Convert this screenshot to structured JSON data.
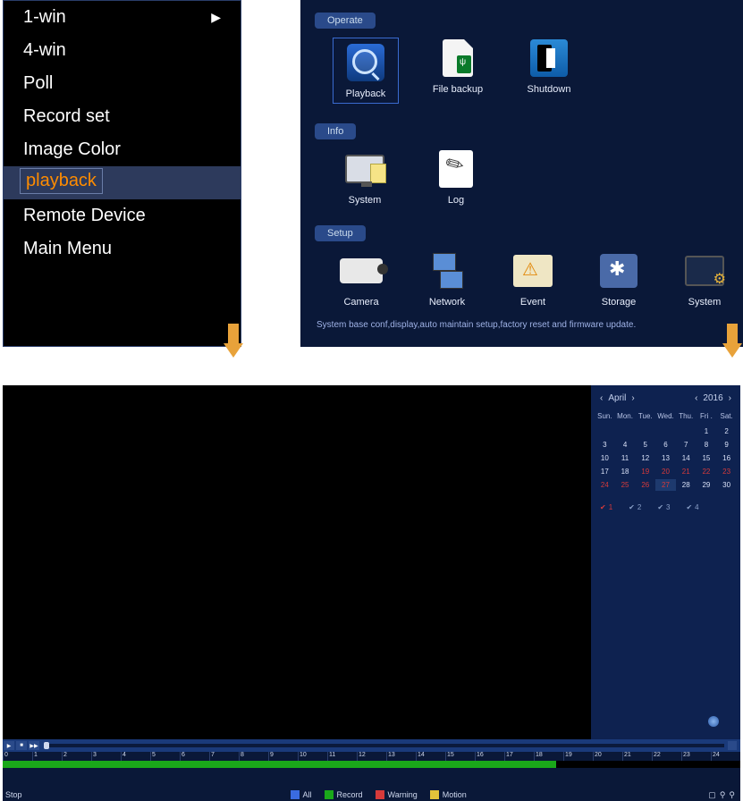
{
  "context_menu": {
    "items": [
      {
        "label": "1-win",
        "has_submenu": true
      },
      {
        "label": "4-win",
        "has_submenu": false
      },
      {
        "label": "Poll",
        "has_submenu": false
      },
      {
        "label": "Record set",
        "has_submenu": false
      },
      {
        "label": "Image Color",
        "has_submenu": false
      },
      {
        "label": "playback",
        "has_submenu": false,
        "selected": true
      },
      {
        "label": "Remote Device",
        "has_submenu": false
      },
      {
        "label": "Main Menu",
        "has_submenu": false
      }
    ],
    "submenu_arrow": "▶"
  },
  "main_menu": {
    "sections": {
      "operate": {
        "tag": "Operate",
        "items": [
          {
            "label": "Playback",
            "selected": true
          },
          {
            "label": "File backup"
          },
          {
            "label": "Shutdown"
          }
        ]
      },
      "info": {
        "tag": "Info",
        "items": [
          {
            "label": "System"
          },
          {
            "label": "Log"
          }
        ]
      },
      "setup": {
        "tag": "Setup",
        "items": [
          {
            "label": "Camera"
          },
          {
            "label": "Network"
          },
          {
            "label": "Event"
          },
          {
            "label": "Storage"
          },
          {
            "label": "System"
          }
        ],
        "desc": "System base conf,display,auto maintain setup,factory reset and firmware update."
      }
    }
  },
  "playback": {
    "calendar": {
      "month": "April",
      "year": "2016",
      "dow": [
        "Sun.",
        "Mon.",
        "Tue.",
        "Wed.",
        "Thu.",
        "Fri .",
        "Sat."
      ],
      "days": [
        {
          "d": "",
          "e": true
        },
        {
          "d": "",
          "e": true
        },
        {
          "d": "",
          "e": true
        },
        {
          "d": "",
          "e": true
        },
        {
          "d": "",
          "e": true
        },
        {
          "d": "1"
        },
        {
          "d": "2"
        },
        {
          "d": "3"
        },
        {
          "d": "4"
        },
        {
          "d": "5"
        },
        {
          "d": "6"
        },
        {
          "d": "7"
        },
        {
          "d": "8"
        },
        {
          "d": "9"
        },
        {
          "d": "10"
        },
        {
          "d": "11"
        },
        {
          "d": "12"
        },
        {
          "d": "13"
        },
        {
          "d": "14"
        },
        {
          "d": "15"
        },
        {
          "d": "16"
        },
        {
          "d": "17"
        },
        {
          "d": "18"
        },
        {
          "d": "19",
          "r": true
        },
        {
          "d": "20",
          "r": true
        },
        {
          "d": "21",
          "r": true
        },
        {
          "d": "22",
          "r": true
        },
        {
          "d": "23",
          "r": true
        },
        {
          "d": "24",
          "r": true
        },
        {
          "d": "25",
          "r": true
        },
        {
          "d": "26",
          "r": true
        },
        {
          "d": "27",
          "r": true,
          "t": true
        },
        {
          "d": "28"
        },
        {
          "d": "29"
        },
        {
          "d": "30"
        }
      ]
    },
    "channels": [
      {
        "n": "1",
        "on": true
      },
      {
        "n": "2",
        "on": false
      },
      {
        "n": "3",
        "on": false
      },
      {
        "n": "4",
        "on": false
      }
    ],
    "controls": {
      "play": "▶",
      "pause": "❚❚",
      "stop": "■",
      "step": "▶▶"
    },
    "timeline": {
      "hours": [
        "0",
        "1",
        "2",
        "3",
        "4",
        "5",
        "6",
        "7",
        "8",
        "9",
        "10",
        "11",
        "12",
        "13",
        "14",
        "15",
        "16",
        "17",
        "18",
        "19",
        "20",
        "21",
        "22",
        "23",
        "24"
      ],
      "filled_percent": 75
    },
    "status": {
      "label": "Stop",
      "legend": {
        "all": {
          "label": "All",
          "color": "#3a6be0"
        },
        "record": {
          "label": "Record",
          "color": "#1aa81a"
        },
        "warning": {
          "label": "Warning",
          "color": "#d73a3a"
        },
        "motion": {
          "label": "Motion",
          "color": "#e2c23a"
        }
      },
      "right_icons": [
        "▢",
        "⚲",
        "⚲"
      ]
    }
  }
}
